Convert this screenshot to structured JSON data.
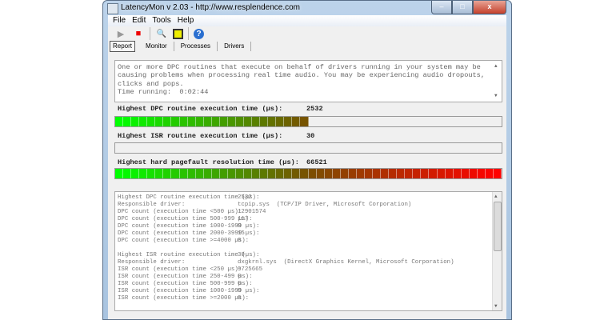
{
  "window": {
    "title": "LatencyMon v 2.03 - http://www.resplendence.com",
    "minimize": "–",
    "maximize": "□",
    "close": "x"
  },
  "menu": [
    "File",
    "Edit",
    "Tools",
    "Help"
  ],
  "toolbar": [
    {
      "icon": "play-icon",
      "glyph": "▶"
    },
    {
      "icon": "stop-icon",
      "glyph": "■"
    },
    {
      "icon": "computer-search-icon",
      "glyph": "🔍"
    },
    {
      "icon": "windows-icon",
      "glyph": "⧉"
    },
    {
      "icon": "help-icon",
      "glyph": "?"
    }
  ],
  "tabs": [
    "Report",
    "Monitor",
    "Processes",
    "Drivers"
  ],
  "report": {
    "text": "One or more DPC routines that execute on behalf of drivers running in your system may be causing problems when processing real time audio. You may be experiencing audio dropouts, clicks and pops.\nTime running:  0:02:44"
  },
  "meters": [
    {
      "label": "Highest DPC routine execution time (µs):",
      "value": "2532",
      "fill": 0.49
    },
    {
      "label": "Highest ISR routine execution time (µs):",
      "value": "30",
      "fill": 0
    },
    {
      "label": "Highest hard pagefault resolution time (µs):",
      "value": "66521",
      "fill": 1.0
    }
  ],
  "details": [
    [
      "Highest DPC routine execution time (µs):",
      "2532"
    ],
    [
      "Responsible driver:",
      "tcpip.sys  (TCP/IP Driver, Microsoft Corporation)"
    ],
    [
      "DPC count (execution time <500 µs):",
      "12901574"
    ],
    [
      "DPC count (execution time 500-999 µs):",
      "117"
    ],
    [
      "DPC count (execution time 1000-1999 µs):",
      "0"
    ],
    [
      "DPC count (execution time 2000-3999 µs):",
      "15"
    ],
    [
      "DPC count (execution time >=4000 µs):",
      "0"
    ],
    [
      "",
      ""
    ],
    [
      "Highest ISR routine execution time (µs):",
      "30"
    ],
    [
      "Responsible driver:",
      "dxgkrnl.sys  (DirectX Graphics Kernel, Microsoft Corporation)"
    ],
    [
      "ISR count (execution time <250 µs):",
      "9725665"
    ],
    [
      "ISR count (execution time 250-499 µs):",
      "0"
    ],
    [
      "ISR count (execution time 500-999 µs):",
      "0"
    ],
    [
      "ISR count (execution time 1000-1999 µs):",
      "0"
    ],
    [
      "ISR count (execution time >=2000 µs):",
      "0"
    ]
  ]
}
